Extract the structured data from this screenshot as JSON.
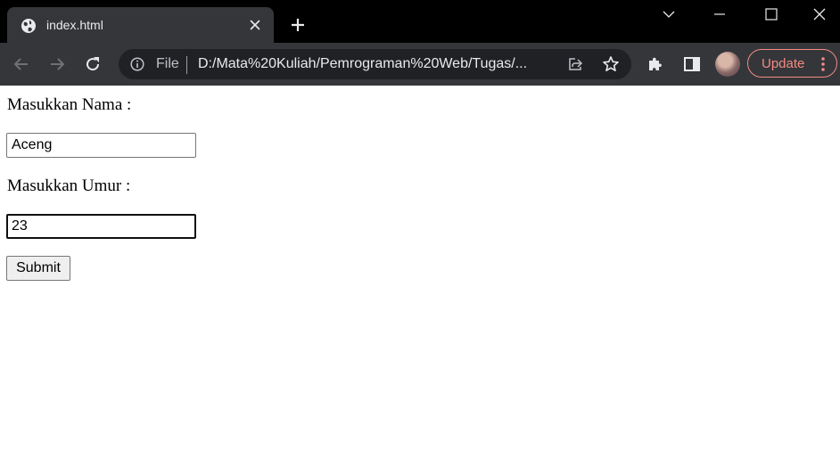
{
  "browser": {
    "tab": {
      "title": "index.html"
    },
    "window_controls": [
      "minimize",
      "maximize",
      "close"
    ],
    "omnibox": {
      "scheme_label": "File",
      "url": "D:/Mata%20Kuliah/Pemrograman%20Web/Tugas/..."
    },
    "update_button": {
      "label": "Update"
    }
  },
  "form": {
    "name_label": "Masukkan Nama :",
    "name_value": "Aceng",
    "age_label": "Masukkan Umur :",
    "age_value": "23",
    "submit_label": "Submit"
  },
  "colors": {
    "tabstrip": "#000000",
    "toolbar": "#35363a",
    "omnibox": "#202124",
    "update_accent": "#f28b82"
  }
}
